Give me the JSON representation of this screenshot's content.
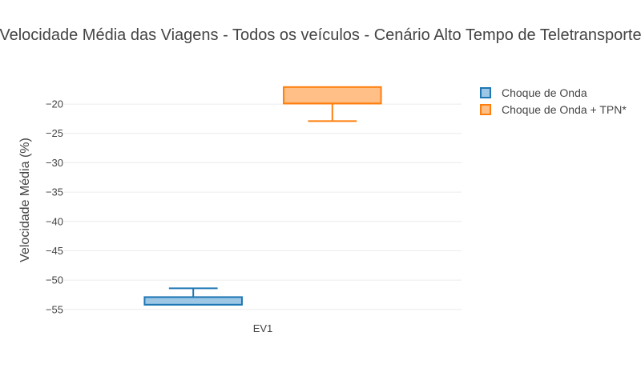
{
  "chart_data": {
    "type": "box",
    "title": "Velocidade Média das Viagens - Todos os veículos - Cenário Alto Tempo de Teletransporte",
    "xlabel": "",
    "ylabel": "Velocidade Média (%)",
    "categories": [
      "EV1"
    ],
    "ylim": [
      -56.8,
      -15.9
    ],
    "yticks": [
      -20,
      -25,
      -30,
      -35,
      -40,
      -45,
      -50,
      -55
    ],
    "ytick_labels": [
      "−20",
      "−25",
      "−30",
      "−35",
      "−40",
      "−45",
      "−50",
      "−55"
    ],
    "grid": true,
    "legend_position": "top-right",
    "series": [
      {
        "name": "Choque de Onda",
        "color": "#1f77b4",
        "fill": "#9ec7e6",
        "box": {
          "whisker_low": -54.2,
          "q1": -54.2,
          "median": -54.2,
          "q3": -52.9,
          "whisker_high": -51.4
        }
      },
      {
        "name": "Choque de Onda + TPN*",
        "color": "#ff7f0e",
        "fill": "#ffbf86",
        "box": {
          "whisker_low": -22.9,
          "q1": -19.9,
          "median": -19.9,
          "q3": -17.1,
          "whisker_high": -17.1
        }
      }
    ]
  }
}
